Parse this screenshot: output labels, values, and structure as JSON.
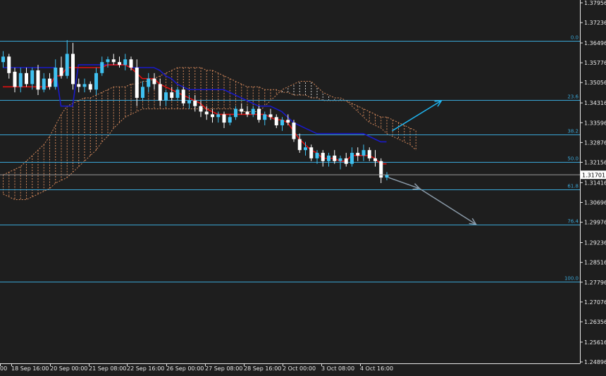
{
  "chart_data": {
    "type": "candlestick",
    "y_axis": {
      "ticks": [
        "1.37956",
        "1.37236",
        "1.36496",
        "1.35776",
        "1.35056",
        "1.34316",
        "1.33596",
        "1.32876",
        "1.32156",
        "1.31416",
        "1.30696",
        "1.29976",
        "1.29236",
        "1.28516",
        "1.27796",
        "1.27076",
        "1.26356",
        "1.25616",
        "1.24896"
      ],
      "range": [
        1.24896,
        1.37956
      ]
    },
    "x_axis": {
      "ticks": [
        "00",
        "18 Sep 16:00",
        "20 Sep 00:00",
        "21 Sep 08:00",
        "22 Sep 16:00",
        "26 Sep 00:00",
        "27 Sep 08:00",
        "28 Sep 16:00",
        "2 Oct 00:00",
        "3 Oct 08:00",
        "4 Oct 16:00"
      ]
    },
    "current_price": "1.31701",
    "fibonacci": [
      {
        "label": "0.0",
        "price": 1.3657
      },
      {
        "label": "23.6",
        "price": 1.3441
      },
      {
        "label": "38.2",
        "price": 1.3318
      },
      {
        "label": "50.0",
        "price": 1.3216
      },
      {
        "label": "61.8",
        "price": 1.3118
      },
      {
        "label": "76.4",
        "price": 1.299
      },
      {
        "label": "100.0",
        "price": 1.2781
      }
    ],
    "candles": [
      [
        1.358,
        1.362,
        1.356,
        1.36
      ],
      [
        1.36,
        1.361,
        1.352,
        1.354
      ],
      [
        1.3545,
        1.356,
        1.347,
        1.349
      ],
      [
        1.349,
        1.356,
        1.347,
        1.354
      ],
      [
        1.354,
        1.356,
        1.349,
        1.35
      ],
      [
        1.35,
        1.356,
        1.348,
        1.355
      ],
      [
        1.355,
        1.357,
        1.346,
        1.348
      ],
      [
        1.348,
        1.354,
        1.347,
        1.352
      ],
      [
        1.352,
        1.354,
        1.348,
        1.349
      ],
      [
        1.349,
        1.359,
        1.348,
        1.356
      ],
      [
        1.356,
        1.36,
        1.352,
        1.353
      ],
      [
        1.353,
        1.366,
        1.352,
        1.361
      ],
      [
        1.361,
        1.365,
        1.348,
        1.35
      ],
      [
        1.35,
        1.352,
        1.347,
        1.349
      ],
      [
        1.349,
        1.352,
        1.347,
        1.35
      ],
      [
        1.35,
        1.351,
        1.347,
        1.348
      ],
      [
        1.348,
        1.356,
        1.346,
        1.354
      ],
      [
        1.354,
        1.36,
        1.353,
        1.358
      ],
      [
        1.358,
        1.36,
        1.356,
        1.359
      ],
      [
        1.359,
        1.361,
        1.357,
        1.358
      ],
      [
        1.358,
        1.36,
        1.356,
        1.357
      ],
      [
        1.357,
        1.361,
        1.355,
        1.359
      ],
      [
        1.359,
        1.36,
        1.355,
        1.356
      ],
      [
        1.356,
        1.359,
        1.342,
        1.345
      ],
      [
        1.345,
        1.351,
        1.344,
        1.349
      ],
      [
        1.349,
        1.354,
        1.347,
        1.352
      ],
      [
        1.352,
        1.354,
        1.348,
        1.35
      ],
      [
        1.35,
        1.352,
        1.342,
        1.344
      ],
      [
        1.344,
        1.348,
        1.342,
        1.347
      ],
      [
        1.347,
        1.349,
        1.344,
        1.345
      ],
      [
        1.345,
        1.349,
        1.344,
        1.348
      ],
      [
        1.348,
        1.349,
        1.342,
        1.343
      ],
      [
        1.343,
        1.346,
        1.341,
        1.344
      ],
      [
        1.344,
        1.346,
        1.34,
        1.342
      ],
      [
        1.342,
        1.344,
        1.338,
        1.34
      ],
      [
        1.34,
        1.342,
        1.337,
        1.339
      ],
      [
        1.339,
        1.341,
        1.336,
        1.338
      ],
      [
        1.338,
        1.34,
        1.336,
        1.339
      ],
      [
        1.339,
        1.34,
        1.334,
        1.336
      ],
      [
        1.336,
        1.339,
        1.335,
        1.338
      ],
      [
        1.338,
        1.342,
        1.337,
        1.341
      ],
      [
        1.341,
        1.343,
        1.339,
        1.34
      ],
      [
        1.34,
        1.342,
        1.338,
        1.339
      ],
      [
        1.339,
        1.342,
        1.338,
        1.341
      ],
      [
        1.341,
        1.342,
        1.336,
        1.337
      ],
      [
        1.337,
        1.34,
        1.335,
        1.339
      ],
      [
        1.339,
        1.341,
        1.337,
        1.338
      ],
      [
        1.338,
        1.339,
        1.334,
        1.335
      ],
      [
        1.335,
        1.338,
        1.333,
        1.337
      ],
      [
        1.337,
        1.339,
        1.335,
        1.336
      ],
      [
        1.336,
        1.337,
        1.329,
        1.33
      ],
      [
        1.33,
        1.332,
        1.325,
        1.326
      ],
      [
        1.326,
        1.329,
        1.324,
        1.327
      ],
      [
        1.327,
        1.328,
        1.322,
        1.323
      ],
      [
        1.323,
        1.326,
        1.321,
        1.325
      ],
      [
        1.325,
        1.326,
        1.32,
        1.322
      ],
      [
        1.322,
        1.325,
        1.32,
        1.324
      ],
      [
        1.324,
        1.326,
        1.321,
        1.322
      ],
      [
        1.322,
        1.324,
        1.319,
        1.323
      ],
      [
        1.323,
        1.325,
        1.32,
        1.321
      ],
      [
        1.321,
        1.327,
        1.32,
        1.325
      ],
      [
        1.325,
        1.327,
        1.322,
        1.324
      ],
      [
        1.324,
        1.328,
        1.322,
        1.326
      ],
      [
        1.326,
        1.327,
        1.322,
        1.323
      ],
      [
        1.323,
        1.326,
        1.32,
        1.322
      ],
      [
        1.322,
        1.323,
        1.314,
        1.316
      ],
      [
        1.316,
        1.318,
        1.315,
        1.317
      ]
    ],
    "tenkan": [
      1.349,
      1.349,
      1.349,
      1.349,
      1.349,
      1.349,
      1.349,
      1.349,
      1.349,
      1.353,
      1.353,
      1.356,
      1.356,
      1.356,
      1.356,
      1.356,
      1.356,
      1.356,
      1.357,
      1.357,
      1.357,
      1.357,
      1.356,
      1.354,
      1.352,
      1.352,
      1.352,
      1.35,
      1.349,
      1.348,
      1.347,
      1.346,
      1.345,
      1.344,
      1.343,
      1.341,
      1.34,
      1.339,
      1.339,
      1.339,
      1.339,
      1.339,
      1.339,
      1.339,
      1.339,
      1.339,
      1.338,
      1.337,
      1.337,
      1.336,
      1.333,
      1.33,
      1.328,
      1.326,
      1.325,
      1.323,
      1.323,
      1.323,
      1.322,
      1.322,
      1.324,
      1.324,
      1.324,
      1.324,
      1.323,
      1.321,
      1.321
    ],
    "kijun": [
      1.356,
      1.356,
      1.356,
      1.356,
      1.356,
      1.356,
      1.356,
      1.356,
      1.356,
      1.356,
      1.342,
      1.342,
      1.342,
      1.357,
      1.357,
      1.357,
      1.357,
      1.357,
      1.357,
      1.357,
      1.357,
      1.357,
      1.356,
      1.356,
      1.356,
      1.356,
      1.356,
      1.355,
      1.353,
      1.352,
      1.35,
      1.349,
      1.348,
      1.348,
      1.348,
      1.348,
      1.348,
      1.348,
      1.348,
      1.347,
      1.346,
      1.345,
      1.344,
      1.343,
      1.342,
      1.342,
      1.342,
      1.341,
      1.34,
      1.338,
      1.336,
      1.335,
      1.334,
      1.333,
      1.332,
      1.332,
      1.332,
      1.332,
      1.332,
      1.332,
      1.332,
      1.332,
      1.332,
      1.331,
      1.33,
      1.329,
      1.329
    ],
    "cloud_a": [
      1.317,
      1.318,
      1.319,
      1.32,
      1.322,
      1.324,
      1.326,
      1.328,
      1.331,
      1.335,
      1.339,
      1.342,
      1.343,
      1.344,
      1.345,
      1.345,
      1.346,
      1.347,
      1.348,
      1.349,
      1.349,
      1.349,
      1.35,
      1.35,
      1.351,
      1.351,
      1.352,
      1.353,
      1.354,
      1.355,
      1.356,
      1.356,
      1.356,
      1.356,
      1.356,
      1.355,
      1.355,
      1.354,
      1.353,
      1.352,
      1.351,
      1.35,
      1.349,
      1.349,
      1.349,
      1.348,
      1.348,
      1.348,
      1.347,
      1.347,
      1.346,
      1.346,
      1.346,
      1.345,
      1.345,
      1.344,
      1.344,
      1.344,
      1.344,
      1.344,
      1.343,
      1.342,
      1.341,
      1.34,
      1.339,
      1.338,
      1.338,
      1.337,
      1.336,
      1.335,
      1.334,
      1.333
    ],
    "cloud_b": [
      1.31,
      1.309,
      1.308,
      1.308,
      1.308,
      1.309,
      1.31,
      1.311,
      1.312,
      1.314,
      1.315,
      1.316,
      1.318,
      1.32,
      1.322,
      1.324,
      1.326,
      1.329,
      1.331,
      1.334,
      1.336,
      1.338,
      1.339,
      1.34,
      1.341,
      1.341,
      1.341,
      1.341,
      1.341,
      1.341,
      1.341,
      1.341,
      1.341,
      1.341,
      1.341,
      1.341,
      1.341,
      1.341,
      1.341,
      1.341,
      1.341,
      1.34,
      1.34,
      1.34,
      1.34,
      1.342,
      1.344,
      1.346,
      1.348,
      1.349,
      1.35,
      1.351,
      1.351,
      1.351,
      1.349,
      1.347,
      1.346,
      1.345,
      1.345,
      1.344,
      1.342,
      1.34,
      1.338,
      1.336,
      1.335,
      1.334,
      1.332,
      1.331,
      1.33,
      1.329,
      1.328,
      1.326
    ],
    "projection_up": [
      [
        1.333,
        1.344
      ]
    ],
    "projection_down": [
      [
        1.316,
        1.312,
        1.299
      ]
    ],
    "colors": {
      "background": "#1e1e1e",
      "axis_text": "#e8e8e8",
      "grid_line": "#3aa6d6",
      "fib_label": "#3aa6d6",
      "bull_candle": "#3fc1f0",
      "bear_candle": "#ffffff",
      "tenkan": "#e01010",
      "kijun": "#1a1ac8",
      "cloud_a": "#d2875a",
      "cloud_b": "#cccccc",
      "arrow_up": "#1fb3ee",
      "arrow_down": "#8a9aa8"
    }
  }
}
